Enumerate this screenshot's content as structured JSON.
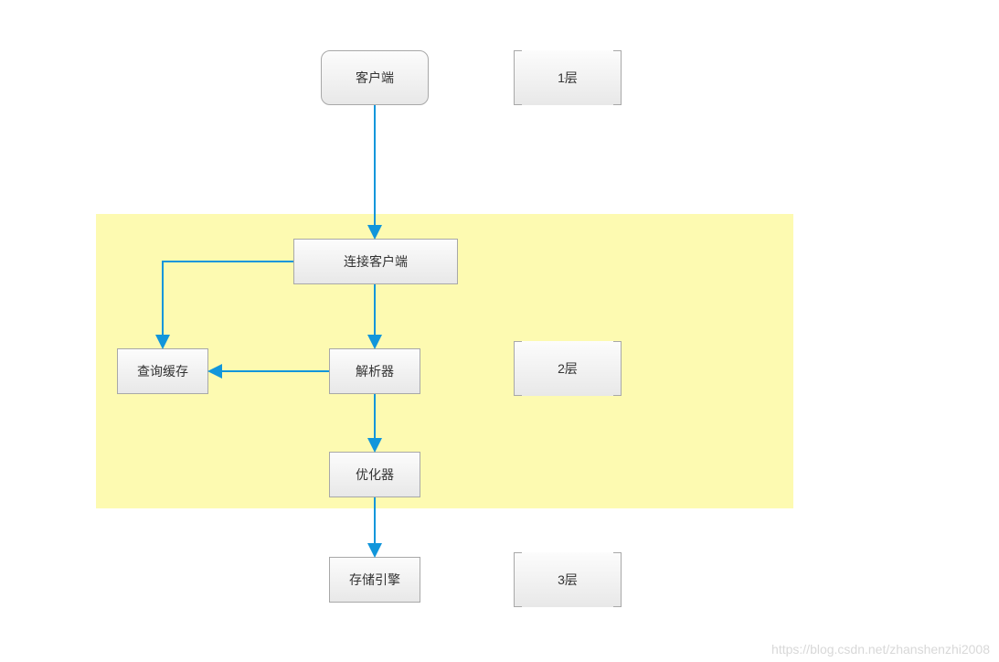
{
  "nodes": {
    "client": "客户端",
    "connect_client": "连接客户端",
    "query_cache": "查询缓存",
    "parser": "解析器",
    "optimizer": "优化器",
    "storage_engine": "存储引擎"
  },
  "layers": {
    "layer1": "1层",
    "layer2": "2层",
    "layer3": "3层"
  },
  "watermark": "https://blog.csdn.net/zhanshenzhi2008"
}
